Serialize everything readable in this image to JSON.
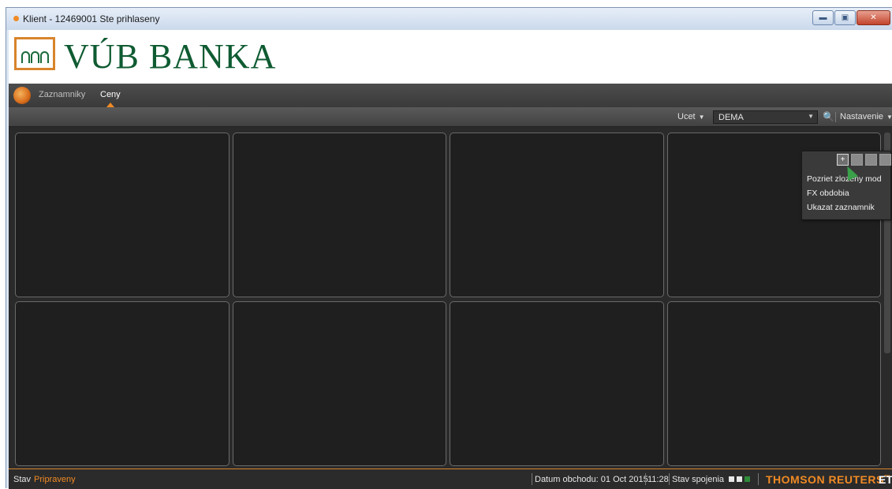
{
  "window": {
    "title": "Klient - 12469001 Ste prihlaseny",
    "minimize_symbol": "▬",
    "maximize_symbol": "▣",
    "close_symbol": "✕"
  },
  "logo": {
    "text": "VÚB BANKA",
    "brand_color": "#0f5b32",
    "accent_color": "#d8842c"
  },
  "nav": {
    "items": [
      {
        "label": "Zaznamniky",
        "active": false
      },
      {
        "label": "Ceny",
        "active": true
      }
    ]
  },
  "toolbar": {
    "account_label": "Ucet",
    "account_value": "DEMA",
    "settings_label": "Nastavenie",
    "caret": "▼",
    "search_symbol": "🔍"
  },
  "settings_menu": {
    "icons": [
      "plus-icon",
      "window-icon",
      "window-icon-2",
      "page-icon"
    ],
    "plus_symbol": "+",
    "items": [
      "Pozriet zlozeny mod",
      "FX obdobia",
      "Ukazat zaznamnik"
    ]
  },
  "status": {
    "state_label": "Stav",
    "state_value": "Pripraveny",
    "trade_date": "Datum obchodu: 01 Oct 2015",
    "time": "11:28",
    "connection_label": "Stav spojenia",
    "brand": "THOMSON REUTERS",
    "brand_mark": "™",
    "brand_suffix": "ET"
  },
  "colors": {
    "accent": "#f08a24",
    "background": "#2a2a2a",
    "panel": "#1f1f1f"
  }
}
